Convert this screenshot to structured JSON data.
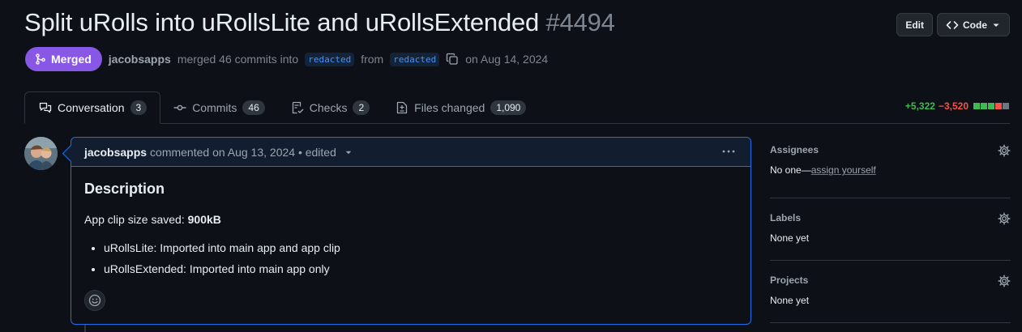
{
  "header": {
    "title": "Split uRolls into uRollsLite and uRollsExtended",
    "number": "#4494",
    "edit_label": "Edit",
    "code_label": "Code"
  },
  "meta": {
    "state": "Merged",
    "author": "jacobsapps",
    "text_merged": "merged 46 commits into",
    "base_branch": "redacted",
    "text_from": "from",
    "head_branch": "redacted",
    "date": "on Aug 14, 2024"
  },
  "tabs": [
    {
      "label": "Conversation",
      "count": "3",
      "icon": "comment-discussion-icon"
    },
    {
      "label": "Commits",
      "count": "46",
      "icon": "git-commit-icon"
    },
    {
      "label": "Checks",
      "count": "2",
      "icon": "checklist-icon"
    },
    {
      "label": "Files changed",
      "count": "1,090",
      "icon": "file-diff-icon"
    }
  ],
  "diffstat": {
    "additions": "+5,322",
    "deletions": "−3,520"
  },
  "comment": {
    "author": "jacobsapps",
    "text": "commented on Aug 13, 2024 • edited",
    "heading": "Description",
    "size_prefix": "App clip size saved: ",
    "size_value": "900kB",
    "items": [
      "uRollsLite: Imported into main app and app clip",
      "uRollsExtended: Imported into main app only"
    ]
  },
  "sidebar": {
    "assignees": {
      "title": "Assignees",
      "value": "No one—",
      "link": "assign yourself"
    },
    "labels": {
      "title": "Labels",
      "value": "None yet"
    },
    "projects": {
      "title": "Projects",
      "value": "None yet"
    }
  },
  "colors": {
    "background": "#0d1117",
    "merged": "#8957e5",
    "additions": "#3fb950",
    "deletions": "#f85149",
    "accent_border": "#1f6feb"
  }
}
